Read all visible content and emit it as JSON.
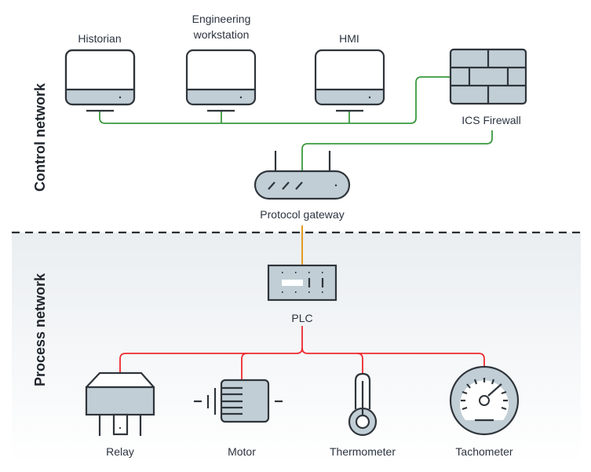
{
  "zones": {
    "control": "Control network",
    "process": "Process network"
  },
  "devices": {
    "historian": "Historian",
    "engineering_line1": "Engineering",
    "engineering_line2": "workstation",
    "hmi": "HMI",
    "firewall": "ICS Firewall",
    "gateway": "Protocol gateway",
    "plc": "PLC",
    "relay": "Relay",
    "motor": "Motor",
    "thermometer": "Thermometer",
    "tachometer": "Tachometer"
  },
  "colors": {
    "control_link": "#3a9a3f",
    "gateway_plc_link": "#e49a22",
    "process_link": "#ee2a2f",
    "device_fill": "#c1ced5",
    "outline": "#2f353b",
    "process_zone_bg": "#eceff2"
  }
}
